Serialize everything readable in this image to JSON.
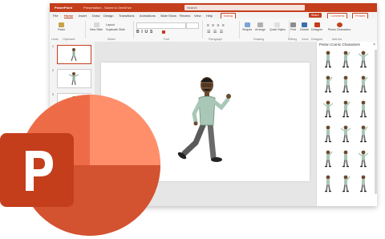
{
  "titlebar": {
    "app_name": "PowerPoint",
    "doc_title": "Presentation - Saved to OneDrive",
    "search_placeholder": "Search",
    "accent_color": "#c43e1c"
  },
  "menubar": {
    "tabs": [
      {
        "label": "File"
      },
      {
        "label": "Home"
      },
      {
        "label": "Insert"
      },
      {
        "label": "Draw"
      },
      {
        "label": "Design"
      },
      {
        "label": "Transitions"
      },
      {
        "label": "Animations"
      },
      {
        "label": "Slide Show"
      },
      {
        "label": "Review"
      },
      {
        "label": "View"
      },
      {
        "label": "Help"
      }
    ],
    "editing_label": "Editing",
    "share_label": "Share",
    "comments_label": "Comments",
    "present_label": "Present"
  },
  "ribbon": {
    "groups": [
      "Undo",
      "Clipboard",
      "Slides",
      "Font",
      "Paragraph",
      "Drawing",
      "Editing",
      "Voice",
      "Designer",
      "Add-ins"
    ],
    "tools": [
      "Paste",
      "New Slide",
      "Layout",
      "Duplicate Slide",
      "Shapes",
      "Arrange",
      "Quick Styles",
      "Find",
      "Dictate",
      "Designer",
      "Pixton Characters"
    ]
  },
  "thumbnails": [
    {
      "number": "1"
    },
    {
      "number": "2"
    },
    {
      "number": "3"
    }
  ],
  "pane": {
    "title": "Pixton Comic Characters"
  },
  "icons": {
    "logo": "powerpoint-logo-icon",
    "close": "close-icon",
    "character": "character-icon"
  }
}
